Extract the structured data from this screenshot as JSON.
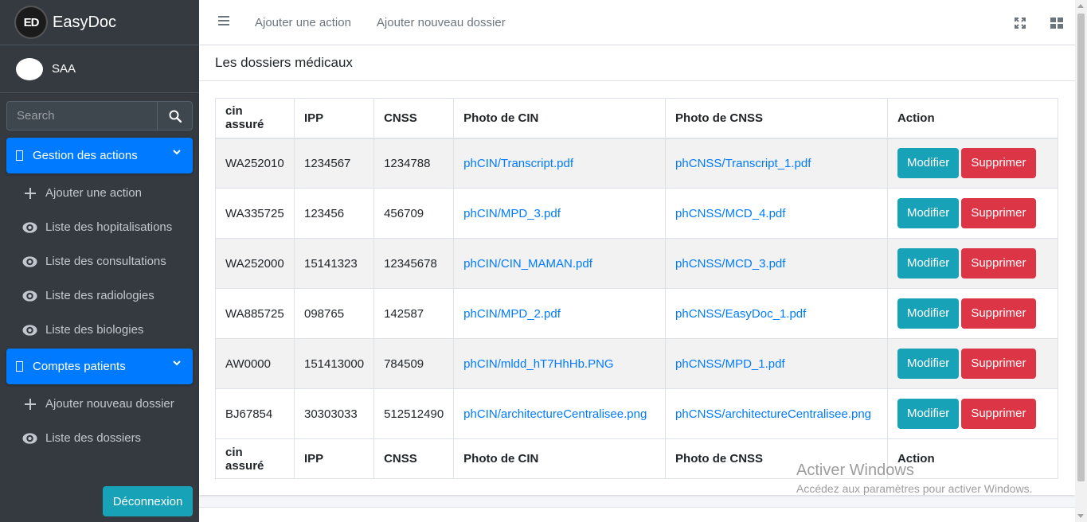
{
  "brand": {
    "logo_text": "ED",
    "name": "EasyDoc"
  },
  "user": {
    "name": "SAA"
  },
  "search": {
    "placeholder": "Search"
  },
  "nav": {
    "gestion_actions": {
      "label": "Gestion des actions",
      "items": [
        {
          "label": "Ajouter une action",
          "icon": "plus-icon"
        },
        {
          "label": "Liste des hopitalisations",
          "icon": "eye-icon"
        },
        {
          "label": "Liste des consultations",
          "icon": "eye-icon"
        },
        {
          "label": "Liste des radiologies",
          "icon": "eye-icon"
        },
        {
          "label": "Liste des biologies",
          "icon": "eye-icon"
        }
      ]
    },
    "comptes_patients": {
      "label": "Comptes patients",
      "items": [
        {
          "label": "Ajouter nouveau dossier",
          "icon": "plus-icon"
        },
        {
          "label": "Liste des dossiers",
          "icon": "eye-icon"
        }
      ]
    },
    "logout_label": "Déconnexion"
  },
  "topbar": {
    "links": [
      "Ajouter une action",
      "Ajouter nouveau dossier"
    ]
  },
  "card": {
    "title": "Les dossiers médicaux"
  },
  "table": {
    "columns": [
      "cin assuré",
      "IPP",
      "CNSS",
      "Photo de CIN",
      "Photo de CNSS",
      "Action"
    ],
    "rows": [
      {
        "cin": "WA252010",
        "ipp": "1234567",
        "cnss": "1234788",
        "photo_cin": "phCIN/Transcript.pdf",
        "photo_cnss": "phCNSS/Transcript_1.pdf"
      },
      {
        "cin": "WA335725",
        "ipp": "123456",
        "cnss": "456709",
        "photo_cin": "phCIN/MPD_3.pdf",
        "photo_cnss": "phCNSS/MCD_4.pdf"
      },
      {
        "cin": "WA252000",
        "ipp": "15141323",
        "cnss": "12345678",
        "photo_cin": "phCIN/CIN_MAMAN.pdf",
        "photo_cnss": "phCNSS/MCD_3.pdf"
      },
      {
        "cin": "WA885725",
        "ipp": "098765",
        "cnss": "142587",
        "photo_cin": "phCIN/MPD_2.pdf",
        "photo_cnss": "phCNSS/EasyDoc_1.pdf"
      },
      {
        "cin": "AW0000",
        "ipp": "151413000",
        "cnss": "784509",
        "photo_cin": "phCIN/mldd_hT7HhHb.PNG",
        "photo_cnss": "phCNSS/MPD_1.pdf"
      },
      {
        "cin": "BJ67854",
        "ipp": "30303033",
        "cnss": "512512490",
        "photo_cin": "phCIN/architectureCentralisee.png",
        "photo_cnss": "phCNSS/architectureCentralisee.png"
      }
    ],
    "edit_label": "Modifier",
    "delete_label": "Supprimer"
  },
  "watermark": {
    "line1": "Activer Windows",
    "line2": "Accédez aux paramètres pour activer Windows."
  },
  "colors": {
    "primary": "#007bff",
    "info": "#17a2b8",
    "danger": "#dc3545",
    "sidebar": "#343a40"
  }
}
